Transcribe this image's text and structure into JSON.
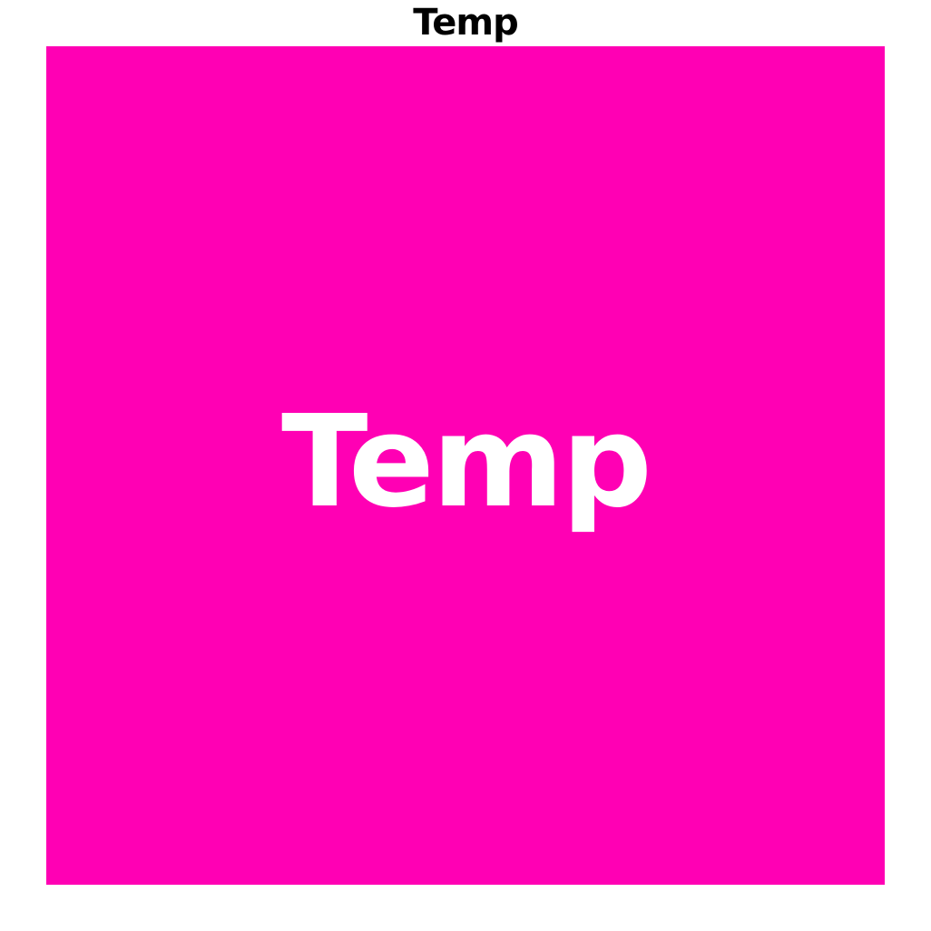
{
  "header": {
    "title": "Temp"
  },
  "tile": {
    "label": "Temp",
    "background_color": "#FF00B4",
    "text_color": "#FFFFFF"
  }
}
